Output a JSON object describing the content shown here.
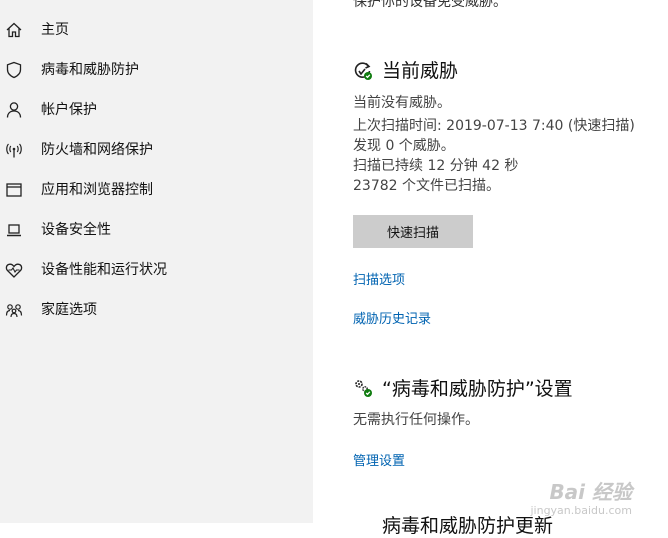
{
  "sidebar": {
    "items": [
      {
        "label": "主页",
        "icon": "home-icon"
      },
      {
        "label": "病毒和威胁防护",
        "icon": "shield-icon"
      },
      {
        "label": "帐户保护",
        "icon": "person-icon"
      },
      {
        "label": "防火墙和网络保护",
        "icon": "wifi-signal-icon"
      },
      {
        "label": "应用和浏览器控制",
        "icon": "browser-window-icon"
      },
      {
        "label": "设备安全性",
        "icon": "laptop-icon"
      },
      {
        "label": "设备性能和运行状况",
        "icon": "heart-pulse-icon"
      },
      {
        "label": "家庭选项",
        "icon": "family-icon"
      }
    ]
  },
  "main": {
    "top_cut_text": "保护你的设备免受威胁。",
    "current_threats": {
      "title": "当前威胁",
      "no_threats": "当前没有威胁。",
      "last_scan": "上次扫描时间: 2019-07-13 7:40 (快速扫描)",
      "found": "发现 0 个威胁。",
      "duration": "扫描已持续 12 分钟 42 秒",
      "files": "23782 个文件已扫描。",
      "quick_scan_button": "快速扫描",
      "scan_options_link": "扫描选项",
      "threat_history_link": "威胁历史记录"
    },
    "settings": {
      "title": "“病毒和威胁防护”设置",
      "no_action": "无需执行任何操作。",
      "manage_link": "管理设置"
    },
    "bottom_cut_text": "病毒和威胁防护更新"
  },
  "watermark": {
    "text": "Bai 经验",
    "sub": "jingyan.baidu.com"
  },
  "colors": {
    "accent": "#0063b1",
    "sidebar_bg": "#f2f2f2",
    "ok_green": "#107c10",
    "button_bg": "#cccccc"
  }
}
